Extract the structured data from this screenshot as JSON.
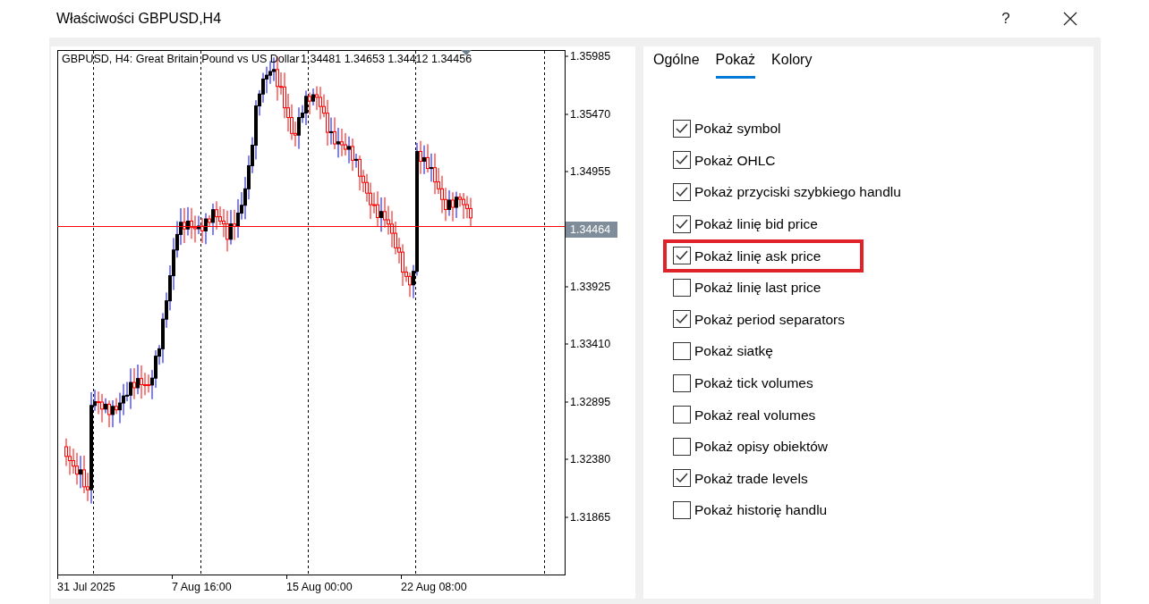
{
  "window": {
    "title": "Właściwości GBPUSD,H4",
    "help": "?"
  },
  "chart": {
    "header": "GBPUSD, H4:  Great Britain Pound vs US Dollar",
    "ohlc": "1.34481 1.34653 1.34412 1.34456",
    "price_labels": [
      "1.35985",
      "1.35470",
      "1.34955",
      "1.34464",
      "1.33925",
      "1.33410",
      "1.32895",
      "1.32380",
      "1.31865"
    ],
    "time_labels": [
      "31 Jul 2025",
      "7 Aug 16:00",
      "15 Aug 00:00",
      "22 Aug 08:00"
    ]
  },
  "tabs": [
    {
      "label": "Ogólne",
      "selected": false
    },
    {
      "label": "Pokaż",
      "selected": true
    },
    {
      "label": "Kolory",
      "selected": false
    }
  ],
  "options": [
    {
      "label": "Pokaż symbol",
      "checked": true,
      "highlighted": false
    },
    {
      "label": "Pokaż OHLC",
      "checked": true,
      "highlighted": false
    },
    {
      "label": "Pokaż przyciski szybkiego handlu",
      "checked": true,
      "highlighted": false
    },
    {
      "label": "Pokaż linię bid price",
      "checked": true,
      "highlighted": false
    },
    {
      "label": "Pokaż linię ask price",
      "checked": true,
      "highlighted": true
    },
    {
      "label": "Pokaż linię last price",
      "checked": false,
      "highlighted": false
    },
    {
      "label": "Pokaż period separators",
      "checked": true,
      "highlighted": false
    },
    {
      "label": "Pokaż siatkę",
      "checked": false,
      "highlighted": false
    },
    {
      "label": "Pokaż tick volumes",
      "checked": false,
      "highlighted": false
    },
    {
      "label": "Pokaż real volumes",
      "checked": false,
      "highlighted": false
    },
    {
      "label": "Pokaż opisy obiektów",
      "checked": false,
      "highlighted": false
    },
    {
      "label": "Pokaż trade levels",
      "checked": true,
      "highlighted": false
    },
    {
      "label": "Pokaż historię handlu",
      "checked": false,
      "highlighted": false
    }
  ]
}
